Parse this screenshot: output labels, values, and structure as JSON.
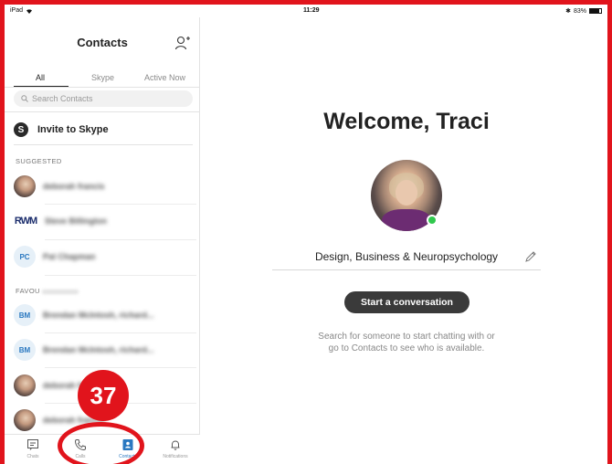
{
  "statusbar": {
    "device": "iPad",
    "time": "11:29",
    "battery": "83%"
  },
  "sidebar": {
    "title": "Contacts",
    "tabs": [
      "All",
      "Skype",
      "Active Now"
    ],
    "search_placeholder": "Search Contacts",
    "invite_label": "Invite to Skype",
    "suggested_label": "SUGGESTED",
    "favourites_label": "FAVOU",
    "contacts": [
      {
        "avatar_type": "photo",
        "initials": "",
        "name": "deborah francis"
      },
      {
        "avatar_type": "logo",
        "initials": "RWM",
        "name": "Steve Billington"
      },
      {
        "avatar_type": "initials",
        "initials": "PC",
        "name": "Pat Chapman"
      },
      {
        "avatar_type": "initials",
        "initials": "BM",
        "name": "Brendan McIntosh, richard..."
      },
      {
        "avatar_type": "initials",
        "initials": "BM",
        "name": "Brendan McIntosh, richard..."
      },
      {
        "avatar_type": "photo",
        "initials": "",
        "name": "deborah francis"
      },
      {
        "avatar_type": "photo",
        "initials": "",
        "name": "deborah francis"
      }
    ]
  },
  "nav": {
    "chats": "Chats",
    "calls": "Calls",
    "contacts": "Contacts",
    "notifications": "Notifications",
    "active": "contacts"
  },
  "main": {
    "welcome": "Welcome, Traci",
    "mood": "Design, Business & Neuropsychology",
    "start_button": "Start a conversation",
    "hint_line1": "Search for someone to start chatting with or",
    "hint_line2": "go to Contacts to see who is available."
  },
  "callout": {
    "number": "37"
  },
  "colors": {
    "accent": "#e1141c",
    "skype_blue": "#2a78c0",
    "online": "#30c84d"
  }
}
